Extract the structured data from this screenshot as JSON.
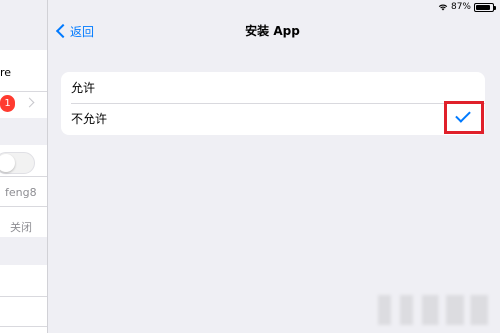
{
  "status_bar": {
    "battery_text": "87%",
    "battery_level": 0.87,
    "wifi_icon": "wifi-icon"
  },
  "left_panel": {
    "partial_label_top": "re",
    "badge_count": "1",
    "username_value": "feng8",
    "status_value": "关闭",
    "toggle_on": false
  },
  "nav": {
    "back_label": "返回",
    "title": "安装 App"
  },
  "options": [
    {
      "label": "允许",
      "selected": false
    },
    {
      "label": "不允许",
      "selected": true
    }
  ],
  "colors": {
    "accent": "#007aff",
    "highlight_box": "#e0202a",
    "badge": "#ff3b30",
    "background": "#efeff4"
  }
}
